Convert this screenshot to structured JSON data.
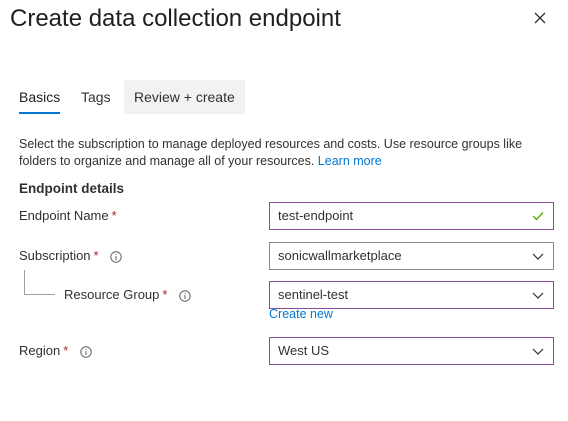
{
  "panel": {
    "title": "Create data collection endpoint",
    "close_icon": "close-icon"
  },
  "tabs": [
    {
      "label": "Basics",
      "active": true
    },
    {
      "label": "Tags",
      "active": false
    },
    {
      "label": "Review + create",
      "active": false
    }
  ],
  "description": {
    "text": "Select the subscription to manage deployed resources and costs. Use resource groups like folders to organize and manage all of your resources.",
    "link": "Learn more"
  },
  "section_title": "Endpoint details",
  "form": {
    "endpoint_name": {
      "label": "Endpoint Name",
      "required_mark": "*",
      "value": "test-endpoint",
      "status_icon": "check-icon"
    },
    "subscription": {
      "label": "Subscription",
      "required_mark": "*",
      "value": "sonicwallmarketplace",
      "info_icon": "info-icon"
    },
    "resource_group": {
      "label": "Resource Group",
      "required_mark": "*",
      "value": "sentinel-test",
      "info_icon": "info-icon",
      "create_new": "Create new"
    },
    "region": {
      "label": "Region",
      "required_mark": "*",
      "value": "West US",
      "info_icon": "info-icon"
    }
  },
  "colors": {
    "accent": "#0078d4",
    "required": "#a4262c",
    "valid": "#57a300",
    "focus_border": "#8a4d97"
  }
}
